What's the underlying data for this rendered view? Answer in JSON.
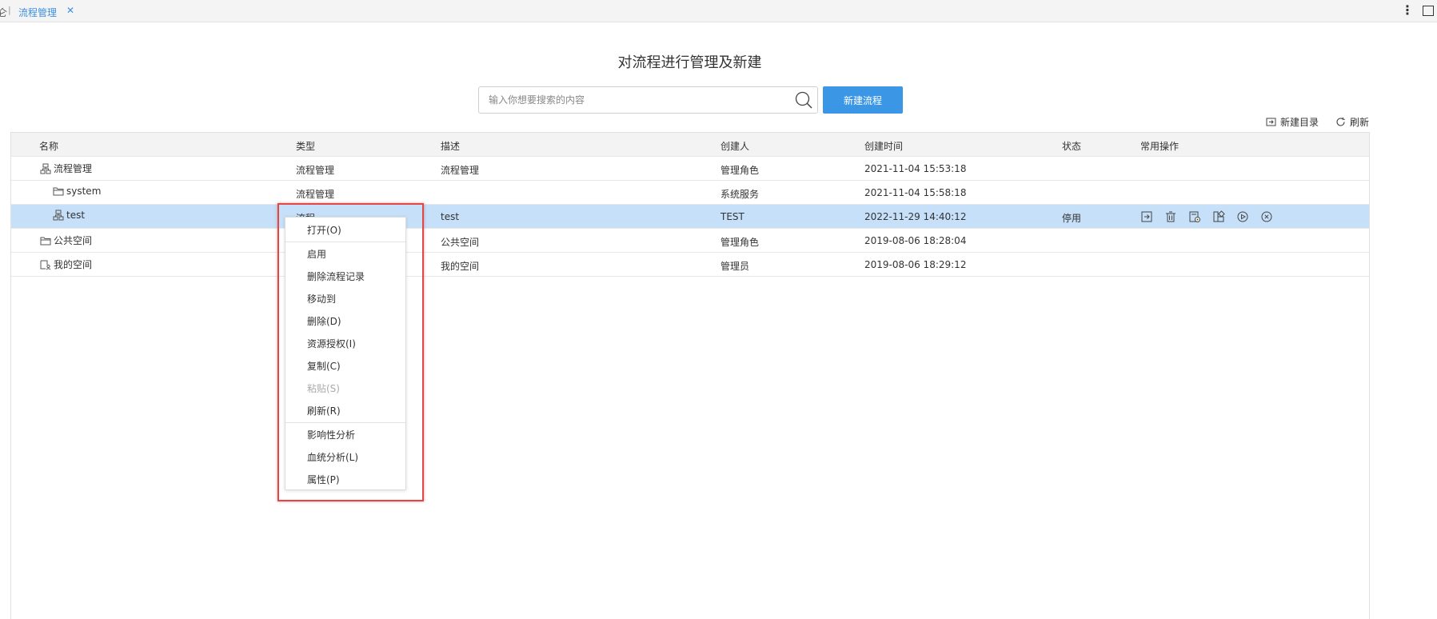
{
  "tabs": {
    "prev_label": "仑",
    "active_label": "流程管理",
    "close_glyph": "✕",
    "more_glyph": "⋮"
  },
  "page_title": "对流程进行管理及新建",
  "search": {
    "placeholder": "输入你想要搜索的内容",
    "value": ""
  },
  "new_flow_label": "新建流程",
  "toolbar": {
    "new_dir_label": "新建目录",
    "refresh_label": "刷新"
  },
  "table": {
    "headers": [
      "名称",
      "类型",
      "描述",
      "创建人",
      "创建时间",
      "状态",
      "常用操作"
    ],
    "rows": [
      {
        "name": "流程管理",
        "icon": "flow-icon",
        "indent": 0,
        "type": "流程管理",
        "desc": "流程管理",
        "creator": "管理角色",
        "time": "2021-11-04 15:53:18",
        "status": ""
      },
      {
        "name": "system",
        "icon": "folder-icon",
        "indent": 1,
        "type": "流程管理",
        "desc": "",
        "creator": "系统服务",
        "time": "2021-11-04 15:58:18",
        "status": ""
      },
      {
        "name": "test",
        "icon": "flow-icon",
        "indent": 1,
        "type": "流程",
        "desc": "test",
        "creator": "TEST",
        "time": "2022-11-29 14:40:12",
        "status": "停用",
        "selected": true
      },
      {
        "name": "公共空间",
        "icon": "folder-icon",
        "indent": 0,
        "type": "",
        "desc": "公共空间",
        "creator": "管理角色",
        "time": "2019-08-06 18:28:04",
        "status": ""
      },
      {
        "name": "我的空间",
        "icon": "user-folder-icon",
        "indent": 0,
        "type": "",
        "desc": "我的空间",
        "creator": "管理员",
        "time": "2019-08-06 18:29:12",
        "status": ""
      }
    ],
    "ops_icons": [
      "move-icon",
      "delete-icon",
      "settings-doc-icon",
      "component-icon",
      "play-icon",
      "cancel-icon"
    ]
  },
  "context_menu": {
    "items": [
      {
        "label": "打开(O)",
        "disabled": false
      },
      {
        "label": "启用",
        "disabled": false
      },
      {
        "label": "删除流程记录",
        "disabled": false
      },
      {
        "label": "移动到",
        "disabled": false
      },
      {
        "label": "删除(D)",
        "disabled": false
      },
      {
        "label": "资源授权(I)",
        "disabled": false
      },
      {
        "label": "复制(C)",
        "disabled": false
      },
      {
        "label": "粘贴(S)",
        "disabled": true
      },
      {
        "label": "刷新(R)",
        "disabled": false
      },
      {
        "label": "影响性分析",
        "disabled": false
      },
      {
        "label": "血统分析(L)",
        "disabled": false
      },
      {
        "label": "属性(P)",
        "disabled": false
      }
    ]
  },
  "colors": {
    "accent": "#3c96e6",
    "selected_row": "#c5e0f8",
    "highlight_border": "#e04848"
  }
}
